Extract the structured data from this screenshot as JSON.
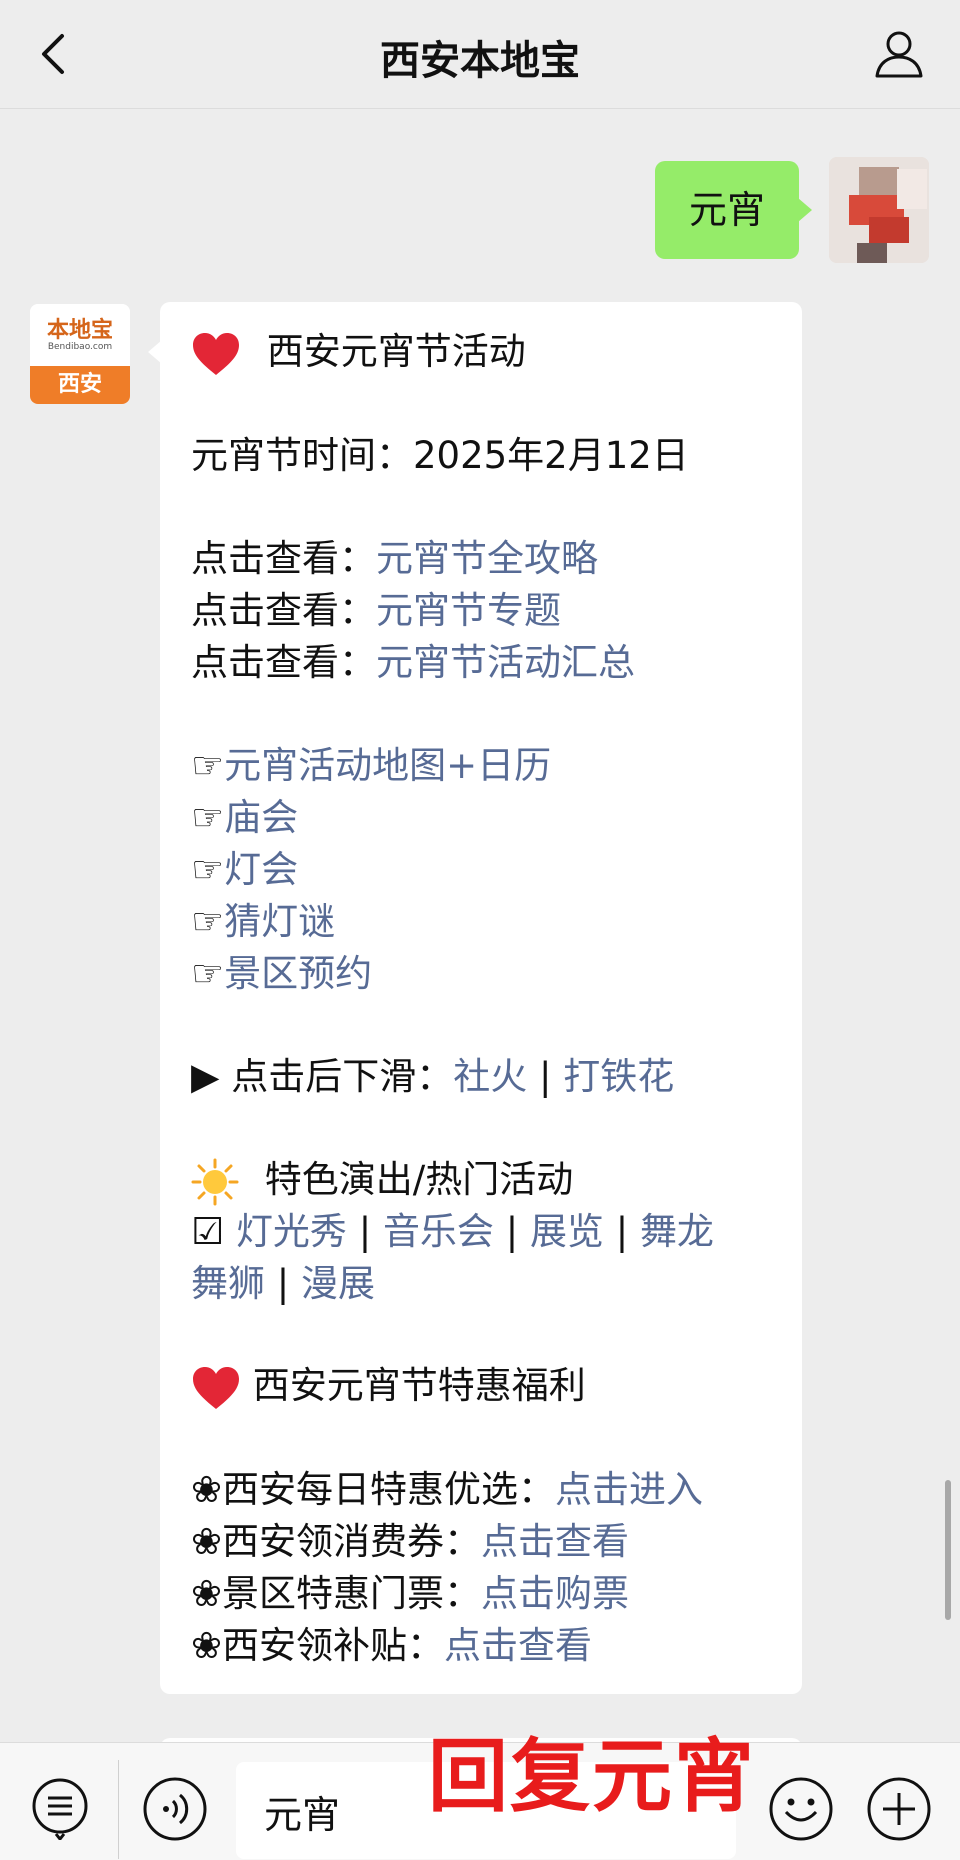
{
  "header": {
    "title": "西安本地宝"
  },
  "sent_message": {
    "text": "元宵"
  },
  "oa_avatar": {
    "logo": "本地宝",
    "logo_sub": "Bendibao.com",
    "city": "西安"
  },
  "reply": {
    "title": "西安元宵节活动",
    "date_line": "元宵节时间：2025年2月12日",
    "views": [
      {
        "prefix": "点击查看：",
        "link": "元宵节全攻略"
      },
      {
        "prefix": "点击查看：",
        "link": "元宵节专题"
      },
      {
        "prefix": "点击查看：",
        "link": "元宵节活动汇总"
      }
    ],
    "hand_links": [
      "元宵活动地图+日历",
      "庙会",
      "灯会",
      "猜灯谜",
      "景区预约"
    ],
    "hand_glyph": "☞",
    "scroll_line": {
      "prefix": "▶ 点击后下滑：",
      "links": [
        "社火",
        "打铁花"
      ]
    },
    "show_title": "特色演出/热门活动",
    "show_links_line1": [
      "灯光秀",
      "音乐会",
      "展览",
      "舞龙"
    ],
    "show_links_line2": [
      "舞狮",
      "漫展"
    ],
    "checkbox_glyph": "☑",
    "benefit_title": "西安元宵节特惠福利",
    "benefits": [
      {
        "prefix": "❀西安每日特惠优选：",
        "link": "点击进入"
      },
      {
        "prefix": "❀西安领消费券：",
        "link": "点击查看"
      },
      {
        "prefix": "❀景区特惠门票：",
        "link": "点击购票"
      },
      {
        "prefix": "❀西安领补贴：",
        "link": "点击查看"
      }
    ],
    "separator": "|"
  },
  "input": {
    "value": "元宵"
  },
  "overlay": {
    "text": "回复元宵"
  },
  "colors": {
    "link": "#576b95",
    "sent_bubble": "#95ec69",
    "overlay": "#e81c1c"
  }
}
